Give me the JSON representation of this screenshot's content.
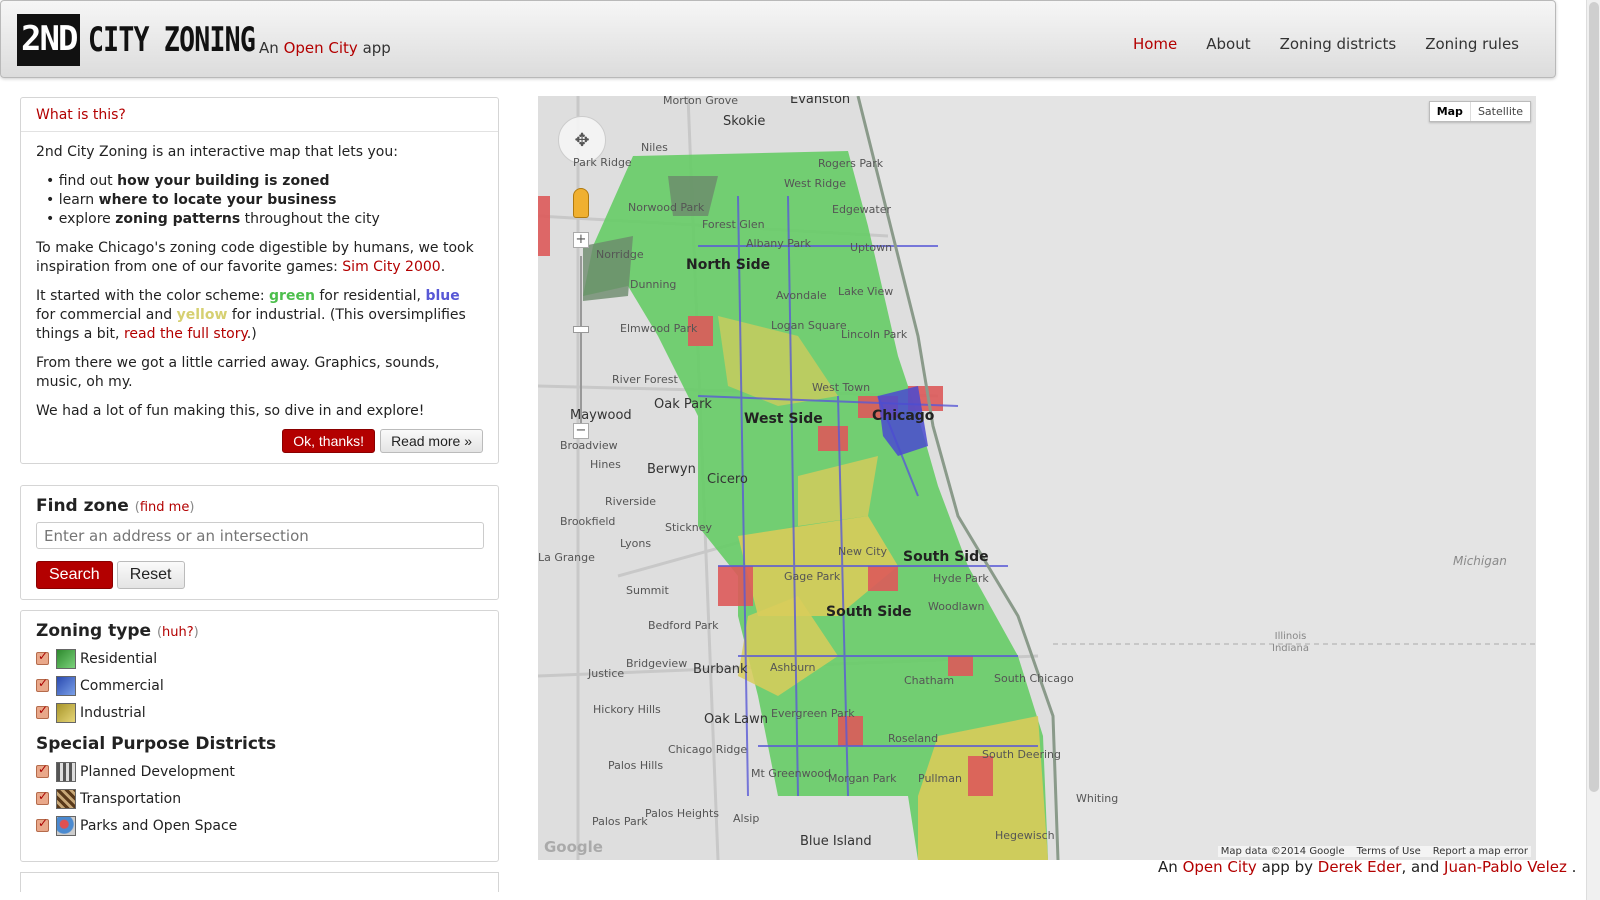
{
  "header": {
    "logo_box": "2ND",
    "logo_text": "CITY ZONING",
    "tagline_prefix": "An",
    "tagline_link": "Open City",
    "tagline_suffix": "app",
    "nav": [
      {
        "label": "Home",
        "active": true
      },
      {
        "label": "About",
        "active": false
      },
      {
        "label": "Zoning districts",
        "active": false
      },
      {
        "label": "Zoning rules",
        "active": false
      }
    ]
  },
  "intro": {
    "heading": "What is this?",
    "lead": "2nd City Zoning is an interactive map that lets you:",
    "bullets": [
      {
        "pre": "find out",
        "bold": "how your building is zoned",
        "post": ""
      },
      {
        "pre": "learn",
        "bold": "where to locate your business",
        "post": ""
      },
      {
        "pre": "explore",
        "bold": "zoning patterns",
        "post": "throughout the city"
      }
    ],
    "p2_text": "To make Chicago's zoning code digestible by humans, we took inspiration from one of our favorite games:",
    "p2_link": "Sim City 2000",
    "p3_a": "It started with the color scheme:",
    "p3_green": "green",
    "p3_b": "for residential,",
    "p3_blue": "blue",
    "p3_c": "for commercial and",
    "p3_yellow": "yellow",
    "p3_d": "for industrial. (This oversimplifies things a bit,",
    "p3_link": "read the full story",
    "p3_e": ".)",
    "p4": "From there we got a little carried away. Graphics, sounds, music, oh my.",
    "p5": "We had a lot of fun making this, so dive in and explore!",
    "ok_button": "Ok, thanks!",
    "more_button": "Read more »"
  },
  "find": {
    "title": "Find zone",
    "find_me": "find me",
    "placeholder": "Enter an address or an intersection",
    "search_button": "Search",
    "reset_button": "Reset"
  },
  "zoning": {
    "title": "Zoning type",
    "huh": "huh?",
    "types": [
      {
        "label": "Residential",
        "checked": true,
        "icon": "residential-icon",
        "color": "#3aa63a"
      },
      {
        "label": "Commercial",
        "checked": true,
        "icon": "commercial-icon",
        "color": "#3a5ac8"
      },
      {
        "label": "Industrial",
        "checked": true,
        "icon": "industrial-icon",
        "color": "#c8b43a"
      }
    ],
    "special_title": "Special Purpose Districts",
    "special": [
      {
        "label": "Planned Development",
        "checked": true,
        "icon": "planned-development-icon",
        "color": "#888888"
      },
      {
        "label": "Transportation",
        "checked": true,
        "icon": "transportation-icon",
        "color": "#7a5a3a"
      },
      {
        "label": "Parks and Open Space",
        "checked": true,
        "icon": "parks-icon",
        "color": "#4a8ad0"
      }
    ]
  },
  "map": {
    "type_map": "Map",
    "type_satellite": "Satellite",
    "labels": {
      "evanston": "Evanston",
      "morton_grove": "Morton Grove",
      "skokie": "Skokie",
      "niles": "Niles",
      "park_ridge": "Park Ridge",
      "rogers_park": "Rogers Park",
      "west_ridge": "West Ridge",
      "edgewater": "Edgewater",
      "norwood_park": "Norwood Park",
      "forest_glen": "Forest Glen",
      "albany_park": "Albany Park",
      "uptown": "Uptown",
      "norridge": "Norridge",
      "north_side": "North Side",
      "dunning": "Dunning",
      "lake_view": "Lake View",
      "avondale": "Avondale",
      "elmwood_park": "Elmwood Park",
      "logan_square": "Logan Square",
      "lincoln_park": "Lincoln Park",
      "river_forest": "River Forest",
      "oak_park": "Oak Park",
      "west_town": "West Town",
      "chicago": "Chicago",
      "maywood": "Maywood",
      "west_side": "West Side",
      "broadview": "Broadview",
      "hines": "Hines",
      "berwyn": "Berwyn",
      "cicero": "Cicero",
      "riverside": "Riverside",
      "brookfield": "Brookfield",
      "lyons": "Lyons",
      "stickney": "Stickney",
      "la_grange": "La Grange",
      "summit": "Summit",
      "new_city": "New City",
      "south_side": "South Side",
      "gage_park": "Gage Park",
      "bedford_park": "Bedford Park",
      "bridgeview": "Bridgeview",
      "burbank": "Burbank",
      "justice": "Justice",
      "ashburn": "Ashburn",
      "hickory_hills": "Hickory Hills",
      "oak_lawn": "Oak Lawn",
      "evergreen_park": "Evergreen Park",
      "chicago_ridge": "Chicago Ridge",
      "palos_hills": "Palos Hills",
      "mt_greenwood": "Mt Greenwood",
      "morgan_park": "Morgan Park",
      "roseland": "Roseland",
      "pullman": "Pullman",
      "south_deering": "South Deering",
      "palos_park": "Palos Park",
      "palos_heights": "Palos Heights",
      "alsip": "Alsip",
      "blue_island": "Blue Island",
      "whiting": "Whiting",
      "hegewisch": "Hegewisch",
      "michigan": "Michigan",
      "illinois_indiana": "Illinois\nIndiana",
      "woodlawn": "Woodlawn",
      "hyde_park": "Hyde Park",
      "chatham": "Chatham",
      "south_chicago": "South Chicago"
    },
    "attribution": [
      "Map data ©2014 Google",
      "Terms of Use",
      "Report a map error"
    ],
    "google": "Google"
  },
  "footer": {
    "prefix": "An",
    "open_city": "Open City",
    "mid": "app by",
    "author1": "Derek Eder",
    "and": ", and",
    "author2": "Juan-Pablo Velez",
    "end": "."
  }
}
